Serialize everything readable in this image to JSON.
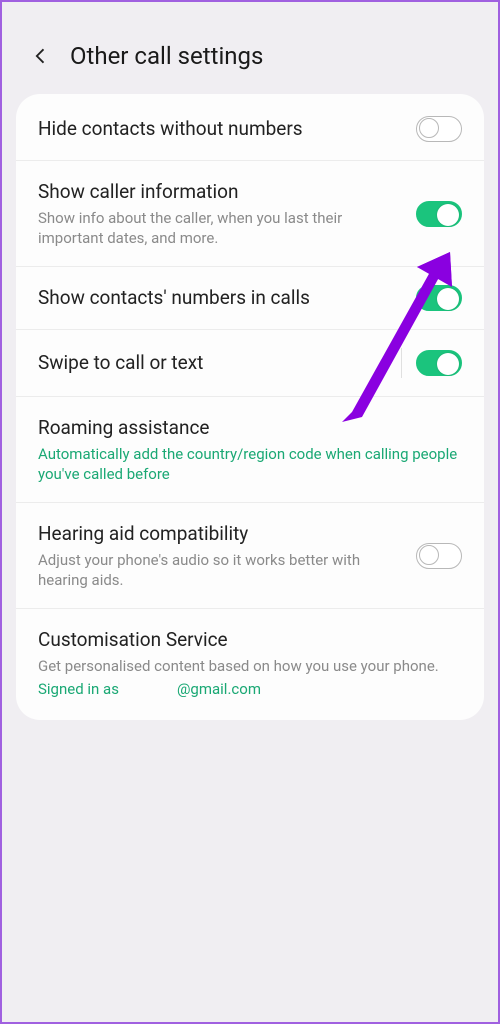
{
  "header": {
    "title": "Other call settings"
  },
  "rows": {
    "hide": {
      "title": "Hide contacts without numbers"
    },
    "caller": {
      "title": "Show caller information",
      "sub": "Show info about the caller, when you last their important dates, and more."
    },
    "contactsNumbers": {
      "title": "Show contacts' numbers in calls"
    },
    "swipe": {
      "title": "Swipe to call or text"
    },
    "roaming": {
      "title": "Roaming assistance",
      "sub": "Automatically add the country/region code when calling people you've called before"
    },
    "hearing": {
      "title": "Hearing aid compatibility",
      "sub": "Adjust your phone's audio so it works better with hearing aids."
    },
    "custom": {
      "title": "Customisation Service",
      "sub": "Get personalised content based on how you use your phone.",
      "signedPrefix": "Signed in as",
      "signedDomain": "@gmail.com"
    }
  },
  "toggles": {
    "hide": false,
    "caller": true,
    "contactsNumbers": true,
    "swipe": true,
    "hearing": false
  },
  "annotation": {
    "arrowColor": "#8a00e0"
  }
}
